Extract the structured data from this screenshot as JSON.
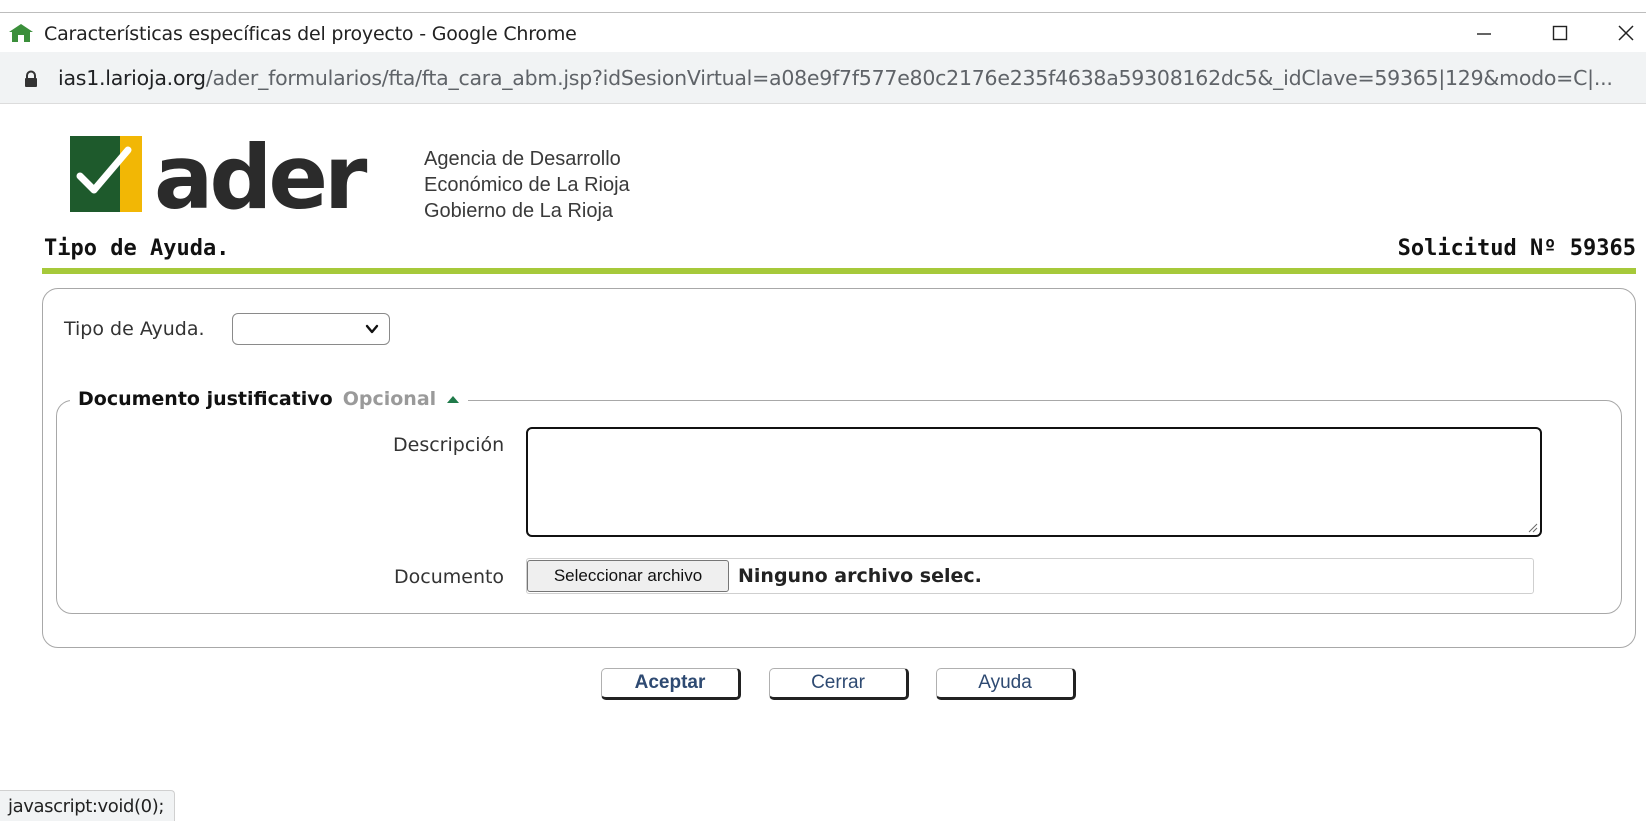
{
  "window": {
    "title": "Características específicas del proyecto - Google Chrome"
  },
  "address_bar": {
    "host": "ias1.larioja.org",
    "path": "/ader_formularios/fta/fta_cara_abm.jsp?idSesionVirtual=a08e9f7f577e80c2176e235f4638a59308162dc5&_idClave=59365|129&modo=C|..."
  },
  "header": {
    "logo_text": "ader",
    "agency_line1": "Agencia de Desarrollo",
    "agency_line2": "Económico de La Rioja",
    "agency_line3": "Gobierno de La Rioja",
    "page_title": "Tipo de Ayuda.",
    "solicitud": "Solicitud Nº 59365"
  },
  "form": {
    "tipo_label": "Tipo de Ayuda.",
    "tipo_selected": "",
    "fieldset_title": "Documento justificativo",
    "fieldset_optional": "Opcional",
    "descripcion_label": "Descripción",
    "descripcion_value": "",
    "documento_label": "Documento",
    "file_button": "Seleccionar archivo",
    "file_status": "Ninguno archivo selec."
  },
  "actions": {
    "aceptar": "Aceptar",
    "cerrar": "Cerrar",
    "ayuda": "Ayuda"
  },
  "status_bar": "javascript:void(0);",
  "colors": {
    "accent_green": "#a6c93a",
    "logo_green": "#1e5a2c",
    "logo_yellow": "#f2b705",
    "button_text": "#2e4a72"
  }
}
